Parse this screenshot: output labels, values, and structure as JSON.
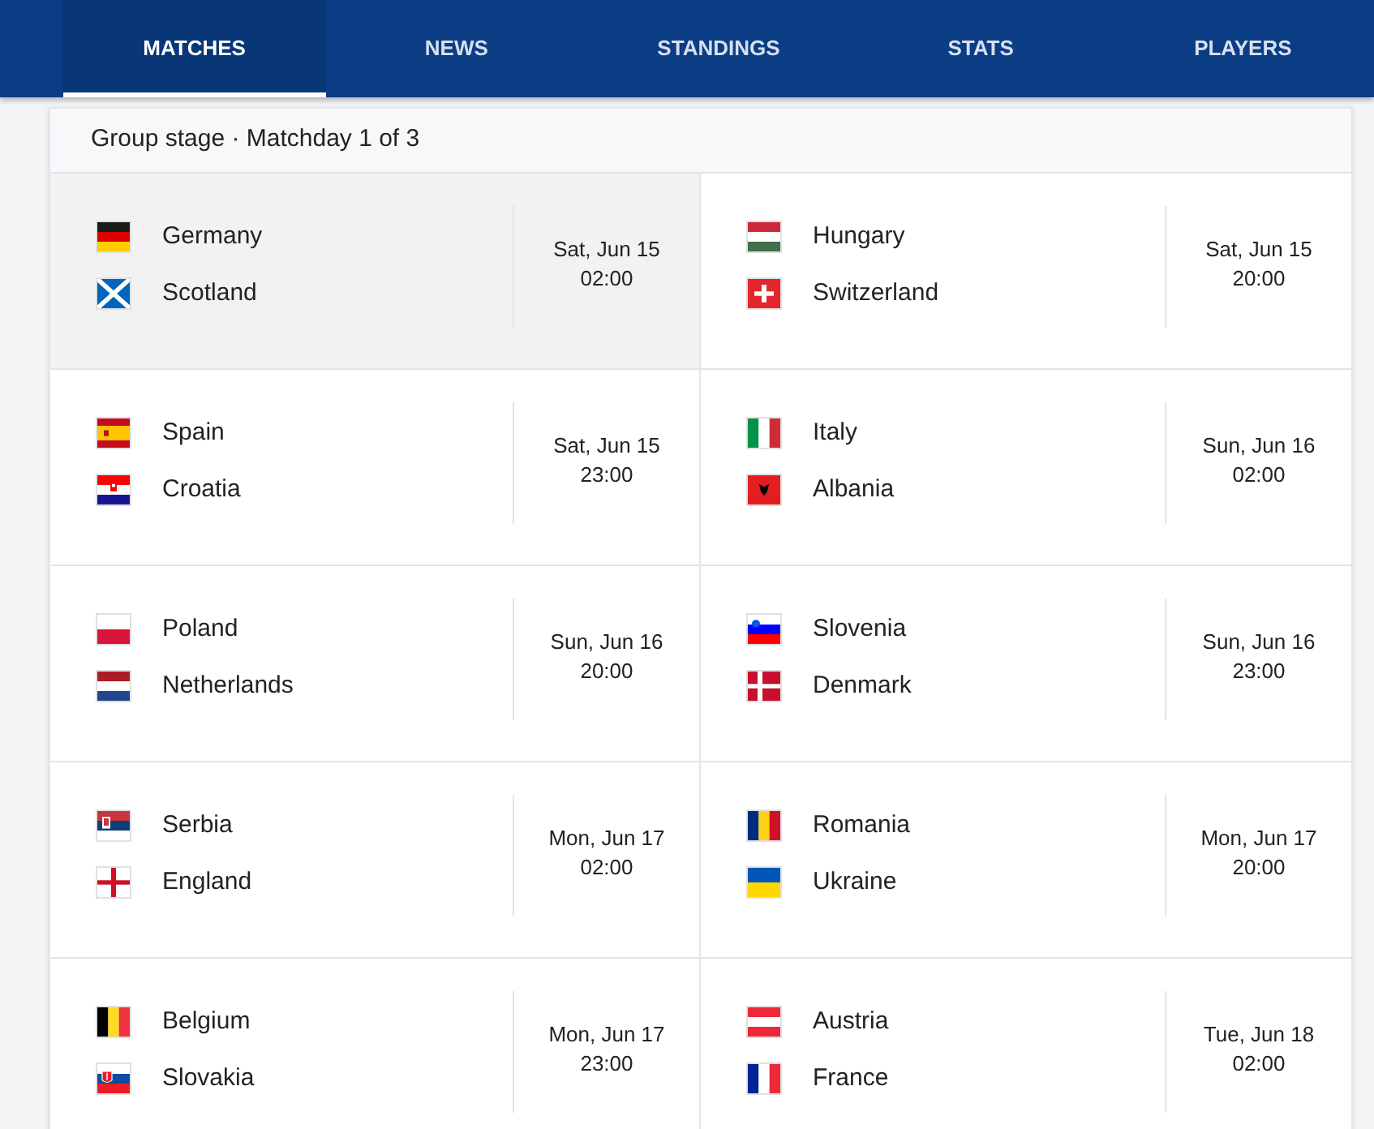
{
  "tabs": [
    {
      "label": "MATCHES",
      "selected": true
    },
    {
      "label": "NEWS",
      "selected": false
    },
    {
      "label": "STANDINGS",
      "selected": false
    },
    {
      "label": "STATS",
      "selected": false
    },
    {
      "label": "PLAYERS",
      "selected": false
    }
  ],
  "section_title": "Group stage · Matchday 1 of 3",
  "matches": [
    {
      "selected": true,
      "teams": [
        {
          "name": "Germany",
          "kind": "de"
        },
        {
          "name": "Scotland",
          "kind": "sco"
        }
      ],
      "date": "Sat, Jun 15",
      "time": "02:00"
    },
    {
      "selected": false,
      "teams": [
        {
          "name": "Hungary",
          "kind": "hu"
        },
        {
          "name": "Switzerland",
          "kind": "ch"
        }
      ],
      "date": "Sat, Jun 15",
      "time": "20:00"
    },
    {
      "selected": false,
      "teams": [
        {
          "name": "Spain",
          "kind": "es"
        },
        {
          "name": "Croatia",
          "kind": "hr"
        }
      ],
      "date": "Sat, Jun 15",
      "time": "23:00"
    },
    {
      "selected": false,
      "teams": [
        {
          "name": "Italy",
          "kind": "it"
        },
        {
          "name": "Albania",
          "kind": "al"
        }
      ],
      "date": "Sun, Jun 16",
      "time": "02:00"
    },
    {
      "selected": false,
      "teams": [
        {
          "name": "Poland",
          "kind": "pl"
        },
        {
          "name": "Netherlands",
          "kind": "nl"
        }
      ],
      "date": "Sun, Jun 16",
      "time": "20:00"
    },
    {
      "selected": false,
      "teams": [
        {
          "name": "Slovenia",
          "kind": "si"
        },
        {
          "name": "Denmark",
          "kind": "dk"
        }
      ],
      "date": "Sun, Jun 16",
      "time": "23:00"
    },
    {
      "selected": false,
      "teams": [
        {
          "name": "Serbia",
          "kind": "rs"
        },
        {
          "name": "England",
          "kind": "eng"
        }
      ],
      "date": "Mon, Jun 17",
      "time": "02:00"
    },
    {
      "selected": false,
      "teams": [
        {
          "name": "Romania",
          "kind": "ro"
        },
        {
          "name": "Ukraine",
          "kind": "ua"
        }
      ],
      "date": "Mon, Jun 17",
      "time": "20:00"
    },
    {
      "selected": false,
      "teams": [
        {
          "name": "Belgium",
          "kind": "be"
        },
        {
          "name": "Slovakia",
          "kind": "sk"
        }
      ],
      "date": "Mon, Jun 17",
      "time": "23:00"
    },
    {
      "selected": false,
      "teams": [
        {
          "name": "Austria",
          "kind": "at"
        },
        {
          "name": "France",
          "kind": "fr"
        }
      ],
      "date": "Tue, Jun 18",
      "time": "02:00"
    }
  ]
}
